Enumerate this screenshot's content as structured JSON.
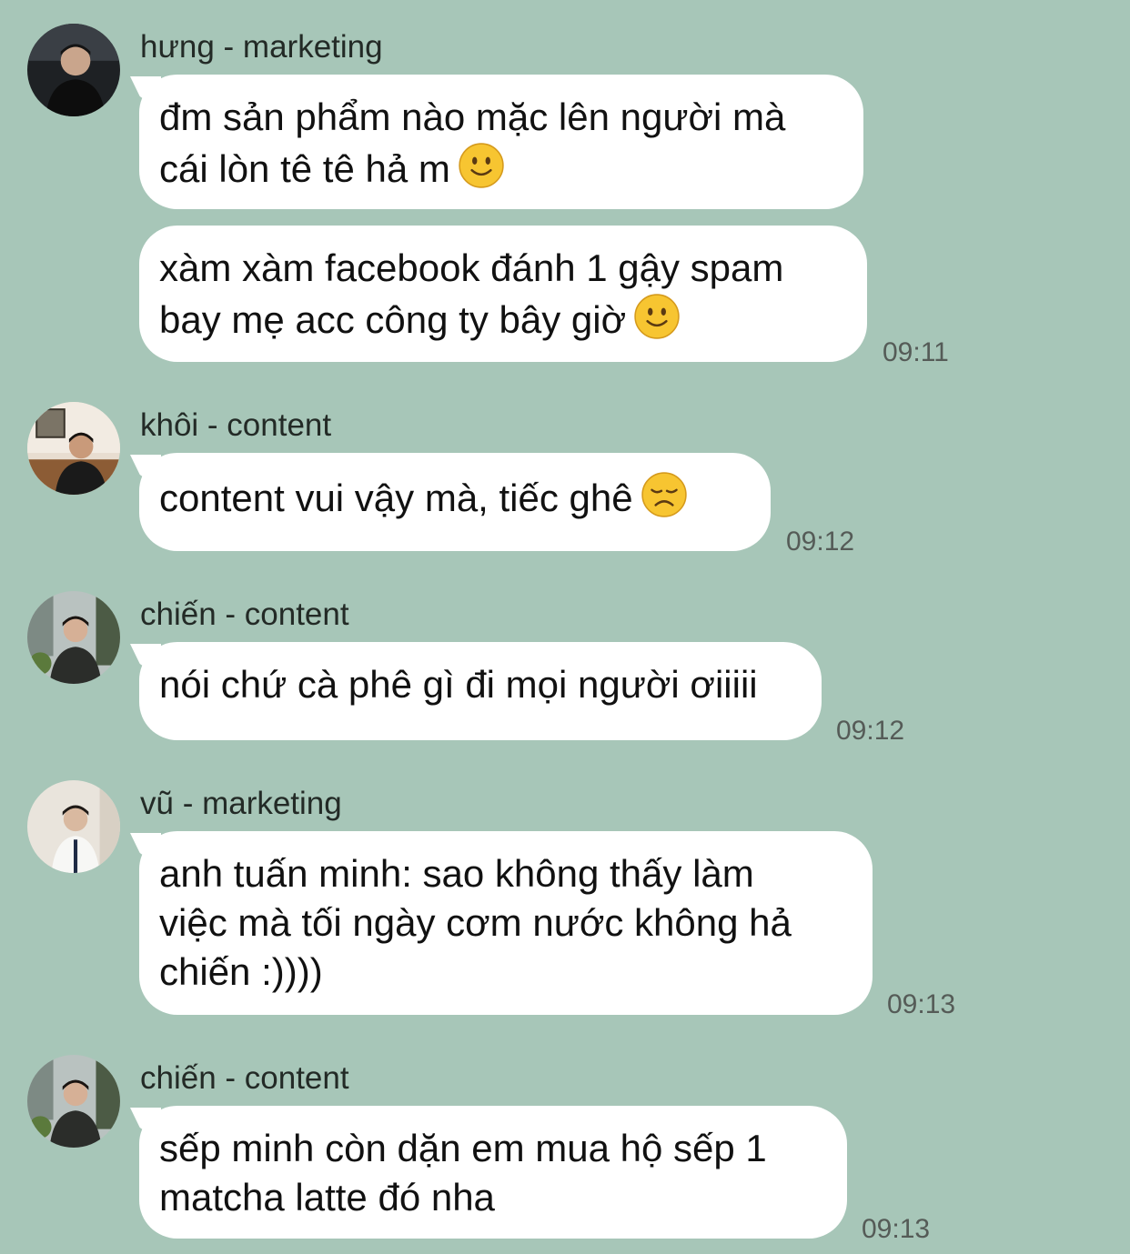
{
  "messages": [
    {
      "sender": "hưng - marketing",
      "avatar": "avatar-hung",
      "bubbles": [
        {
          "text": "đm sản phẩm nào mặc lên người mà\ncái lòn tê tê hả m",
          "emoji": "slightly-smiling-face-icon"
        },
        {
          "text": "xàm xàm facebook đánh 1 gậy spam\nbay mẹ acc công ty bây giờ",
          "emoji": "slightly-smiling-face-icon"
        }
      ],
      "time": "09:11"
    },
    {
      "sender": "khôi - content",
      "avatar": "avatar-khoi",
      "bubbles": [
        {
          "text": "content vui vậy mà, tiếc ghê",
          "emoji": "disappointed-face-icon"
        }
      ],
      "time": "09:12"
    },
    {
      "sender": "chiến - content",
      "avatar": "avatar-chien",
      "bubbles": [
        {
          "text": "nói chứ cà phê gì đi mọi người ơiiiii"
        }
      ],
      "time": "09:12"
    },
    {
      "sender": "vũ - marketing",
      "avatar": "avatar-vu",
      "bubbles": [
        {
          "text": "anh tuấn minh: sao không thấy làm\nviệc mà tối ngày cơm nước không hả\nchiến :))))"
        }
      ],
      "time": "09:13"
    },
    {
      "sender": "chiến - content",
      "avatar": "avatar-chien",
      "bubbles": [
        {
          "text": "sếp minh còn dặn em mua hộ sếp 1\nmatcha latte đó nha"
        }
      ],
      "time": "09:13"
    }
  ]
}
